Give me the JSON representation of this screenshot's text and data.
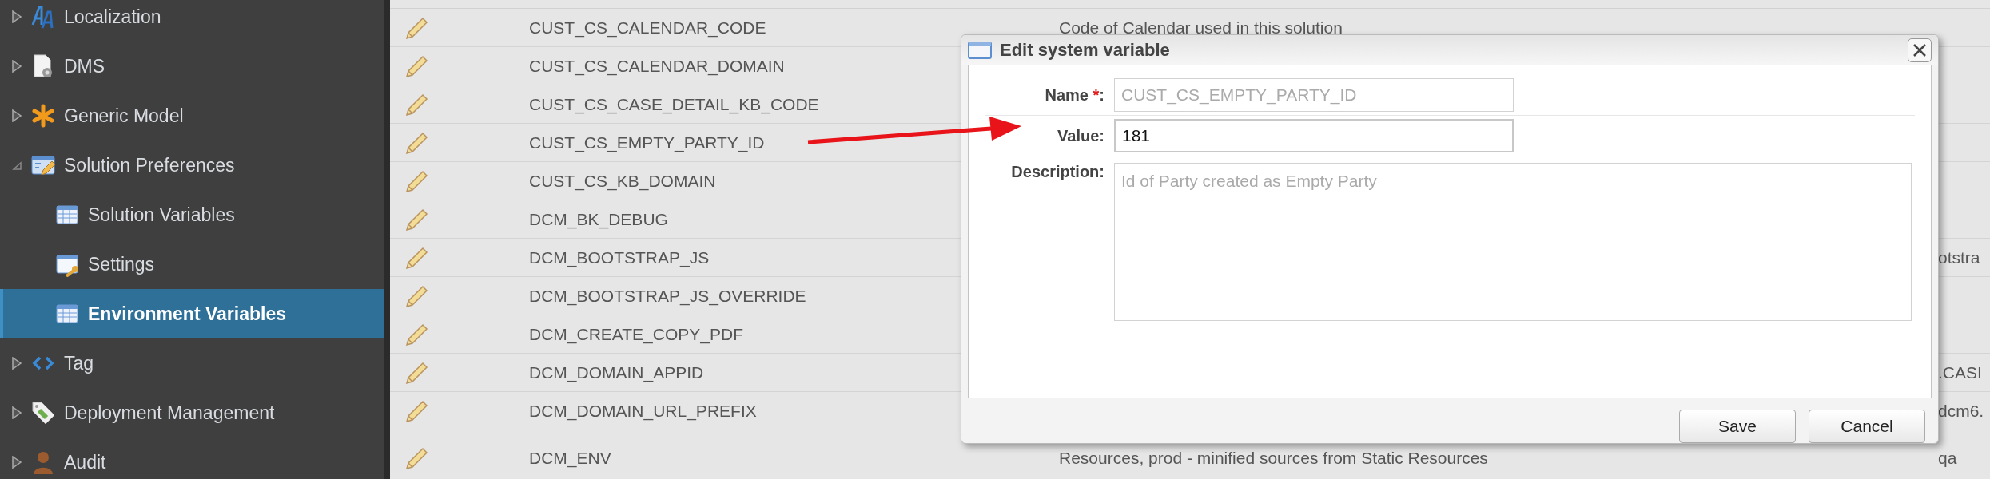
{
  "sidebar": {
    "items": [
      {
        "label": "Localization",
        "kind": "letters",
        "expanded": false,
        "selected": false
      },
      {
        "label": "DMS",
        "kind": "document-gear",
        "expanded": false,
        "selected": false
      },
      {
        "label": "Generic Model",
        "kind": "asterisk",
        "expanded": false,
        "selected": false
      },
      {
        "label": "Solution Preferences",
        "kind": "form-pencil",
        "expanded": true,
        "selected": false,
        "children": [
          {
            "label": "Solution Variables",
            "kind": "table",
            "selected": false
          },
          {
            "label": "Settings",
            "kind": "form-key",
            "selected": false
          },
          {
            "label": "Environment Variables",
            "kind": "table",
            "selected": true
          }
        ]
      },
      {
        "label": "Tag",
        "kind": "code",
        "expanded": false,
        "selected": false
      },
      {
        "label": "Deployment Management",
        "kind": "tag",
        "expanded": false,
        "selected": false
      },
      {
        "label": "Audit",
        "kind": "person",
        "expanded": false,
        "selected": false
      }
    ]
  },
  "table": {
    "rows": [
      {
        "name": "CUST_CS_CALENDAR_CODE",
        "description": "Code of Calendar used in this solution"
      },
      {
        "name": "CUST_CS_CALENDAR_DOMAIN"
      },
      {
        "name": "CUST_CS_CASE_DETAIL_KB_CODE"
      },
      {
        "name": "CUST_CS_EMPTY_PARTY_ID"
      },
      {
        "name": "CUST_CS_KB_DOMAIN"
      },
      {
        "name": "DCM_BK_DEBUG"
      },
      {
        "name": "DCM_BOOTSTRAP_JS",
        "column_3": "otstra"
      },
      {
        "name": "DCM_BOOTSTRAP_JS_OVERRIDE"
      },
      {
        "name": "DCM_CREATE_COPY_PDF"
      },
      {
        "name": "DCM_DOMAIN_APPID",
        "column_3": ".CASI"
      },
      {
        "name": "DCM_DOMAIN_URL_PREFIX",
        "column_3": "dcm6."
      },
      {
        "name": "DCM_ENV",
        "description": "Resources, prod - minified sources from Static Resources",
        "column_3": "qa"
      }
    ]
  },
  "dialog": {
    "title": "Edit system variable",
    "fields": [
      {
        "kind": "input",
        "label": "Name",
        "required_mark": "*",
        "label_end": ":",
        "value": "CUST_CS_EMPTY_PARTY_ID",
        "disabled": true
      },
      {
        "kind": "input",
        "label": "Value:",
        "value": "181",
        "disabled": false
      },
      {
        "kind": "textarea",
        "label": "Description:",
        "value": "Id of Party created as Empty Party",
        "disabled": true
      }
    ],
    "buttons": [
      "Save",
      "Cancel"
    ]
  }
}
